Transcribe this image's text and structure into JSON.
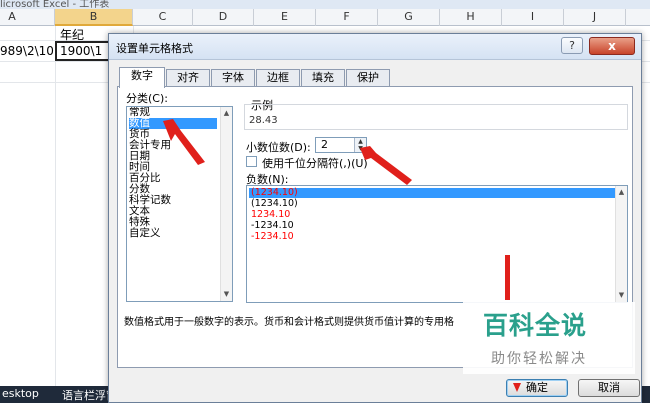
{
  "app": {
    "title_fragment": "licrosoft Excel - 工作表"
  },
  "sheet": {
    "columns": [
      "A",
      "B",
      "C",
      "D",
      "E",
      "F",
      "G",
      "H",
      "I",
      "J"
    ],
    "active_column": "B",
    "b1_value": "年纪",
    "a2_value": "989\\2\\10",
    "b2_value": "1900\\1"
  },
  "dialog": {
    "title": "设置单元格格式",
    "help_label": "?",
    "close_label": "x",
    "tabs": [
      {
        "label": "数字"
      },
      {
        "label": "对齐"
      },
      {
        "label": "字体"
      },
      {
        "label": "边框"
      },
      {
        "label": "填充"
      },
      {
        "label": "保护"
      }
    ],
    "active_tab": "数字",
    "category_label": "分类(C):",
    "categories": [
      "常规",
      "数值",
      "货币",
      "会计专用",
      "日期",
      "时间",
      "百分比",
      "分数",
      "科学记数",
      "文本",
      "特殊",
      "自定义"
    ],
    "selected_category": "数值",
    "sample_label": "示例",
    "sample_value": "28.43",
    "decimal_label": "小数位数(D):",
    "decimal_value": "2",
    "thousands_label": "使用千位分隔符(,)(U)",
    "negative_label": "负数(N):",
    "negative_options": [
      {
        "text": "(1234.10)",
        "color": "#ff0000",
        "selected": true
      },
      {
        "text": "(1234.10)",
        "color": "#000000",
        "selected": false
      },
      {
        "text": "1234.10",
        "color": "#ff0000",
        "selected": false
      },
      {
        "text": "-1234.10",
        "color": "#000000",
        "selected": false
      },
      {
        "text": "-1234.10",
        "color": "#ff0000",
        "selected": false
      }
    ],
    "description": "数值格式用于一般数字的表示。货币和会计格式则提供货币值计算的专用格",
    "ok_label": "确定",
    "cancel_label": "取消"
  },
  "taskbar": {
    "item1": "esktop",
    "item2": "语言栏浮窗"
  },
  "watermark": {
    "main": "百科全说",
    "sub": "助你轻松解决"
  },
  "colors": {
    "selection": "#3399ff",
    "annotation_arrow": "#e0201b",
    "watermark_green": "#2aa08c"
  }
}
